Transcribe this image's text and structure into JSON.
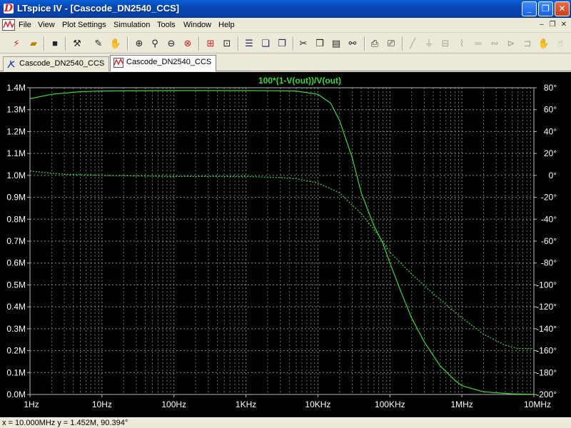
{
  "window": {
    "title": "LTspice IV - [Cascode_DN2540_CCS]",
    "app_icon_glyph": "D"
  },
  "menu": {
    "items": [
      "File",
      "View",
      "Plot Settings",
      "Simulation",
      "Tools",
      "Window",
      "Help"
    ]
  },
  "toolbar": {
    "icons": [
      "run-icon",
      "open-icon",
      "save-icon",
      "control-panel-icon",
      "probe-icon",
      "pan-hand-icon",
      "zoom-in-icon",
      "zoom-out-icon",
      "zoom-fit-icon",
      "zoom-cancel-icon",
      "autorange-icon",
      "grid-icon",
      "tile-horizontal-icon",
      "cascade-icon",
      "tile-vertical-icon",
      "cut-icon",
      "copy-icon",
      "paste-icon",
      "find-icon",
      "print-preview-icon",
      "print-icon",
      "wire-icon",
      "ground-icon",
      "label-icon",
      "resistor-icon",
      "capacitor-icon",
      "inductor-icon",
      "diode-icon",
      "component-icon",
      "move-icon",
      "drag-icon"
    ]
  },
  "tabs": [
    {
      "label": "Cascode_DN2540_CCS",
      "type": "schematic",
      "active": false
    },
    {
      "label": "Cascode_DN2540_CCS",
      "type": "waveform",
      "active": true
    }
  ],
  "status": {
    "text": "x = 10.000MHz    y = 1.452M, 90.394°"
  },
  "colors": {
    "trace": "#33dd33",
    "grid": "#8a8a8a",
    "background": "#000000",
    "text": "#ffffff"
  },
  "chart_data": {
    "type": "line",
    "title": "100*(1-V(out))/V(out)",
    "x_scale": "log",
    "x_ticks": [
      "1Hz",
      "10Hz",
      "100Hz",
      "1KHz",
      "10KHz",
      "100KHz",
      "1MHz",
      "10MHz"
    ],
    "x_range_hz": [
      1,
      10000000
    ],
    "y_left_ticks": [
      "0.0M",
      "0.1M",
      "0.2M",
      "0.3M",
      "0.4M",
      "0.5M",
      "0.6M",
      "0.7M",
      "0.8M",
      "0.9M",
      "1.0M",
      "1.1M",
      "1.2M",
      "1.3M",
      "1.4M"
    ],
    "y_left_range": [
      0,
      1400000
    ],
    "y_right_ticks": [
      "-200°",
      "-180°",
      "-160°",
      "-140°",
      "-120°",
      "-100°",
      "-80°",
      "-60°",
      "-40°",
      "-20°",
      "0°",
      "20°",
      "40°",
      "60°",
      "80°"
    ],
    "y_right_range": [
      -200,
      80
    ],
    "grid": true,
    "series": [
      {
        "axis": "left",
        "style": "solid",
        "points": [
          [
            1,
            1350000
          ],
          [
            2,
            1370000
          ],
          [
            5,
            1382000
          ],
          [
            10,
            1385000
          ],
          [
            100,
            1387000
          ],
          [
            1000,
            1387000
          ],
          [
            5000,
            1385000
          ],
          [
            10000,
            1370000
          ],
          [
            15000,
            1330000
          ],
          [
            20000,
            1250000
          ],
          [
            30000,
            1080000
          ],
          [
            40000,
            920000
          ],
          [
            60000,
            770000
          ],
          [
            80000,
            690000
          ],
          [
            100000,
            600000
          ],
          [
            150000,
            450000
          ],
          [
            200000,
            350000
          ],
          [
            300000,
            240000
          ],
          [
            500000,
            130000
          ],
          [
            800000,
            65000
          ],
          [
            1000000,
            40000
          ],
          [
            2000000,
            12000
          ],
          [
            5000000,
            3000
          ],
          [
            10000000,
            1000
          ]
        ]
      },
      {
        "axis": "right",
        "style": "dashed",
        "points": [
          [
            1,
            4
          ],
          [
            2,
            2
          ],
          [
            3,
            1
          ],
          [
            10,
            0
          ],
          [
            100,
            -1
          ],
          [
            1000,
            -1
          ],
          [
            3000,
            -2
          ],
          [
            5000,
            -3
          ],
          [
            10000,
            -7
          ],
          [
            20000,
            -16
          ],
          [
            40000,
            -35
          ],
          [
            70000,
            -55
          ],
          [
            100000,
            -70
          ],
          [
            200000,
            -90
          ],
          [
            400000,
            -108
          ],
          [
            1000000,
            -130
          ],
          [
            2000000,
            -145
          ],
          [
            4000000,
            -155
          ],
          [
            6000000,
            -158
          ],
          [
            10000000,
            -158
          ]
        ]
      }
    ]
  }
}
